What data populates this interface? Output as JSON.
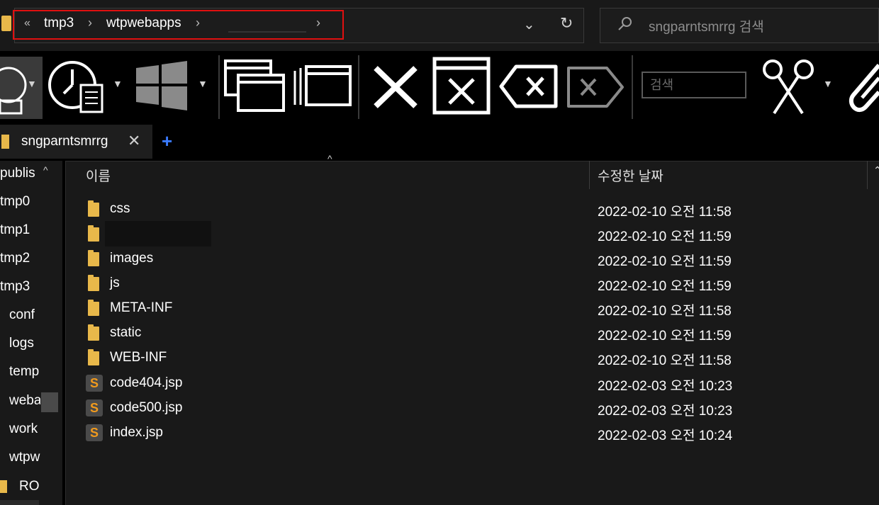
{
  "address": {
    "overflow": "«",
    "crumbs": [
      "tmp3",
      "wtpwebapps"
    ],
    "separator": "›",
    "chevron": "⌄",
    "refresh": "↻"
  },
  "search": {
    "placeholder": "sngparntsmrrg 검색"
  },
  "toolbar": {
    "search_placeholder": "검색",
    "items": [
      "drive-icon",
      "recent-files-icon",
      "windows-icon",
      "new-window-icon",
      "cascade-windows-icon",
      "close-icon",
      "close-window-icon",
      "backspace-icon",
      "tag-close-icon",
      "scissors-icon",
      "paperclip-icon"
    ]
  },
  "tabs": {
    "active_label": "sngparntsmrrg",
    "close": "✕",
    "add": "+"
  },
  "sidebar": {
    "items": [
      "publis",
      "tmp0",
      "tmp1",
      "tmp2",
      "tmp3",
      "conf",
      "logs",
      "temp",
      "weba",
      "work",
      "wtpw",
      "RO"
    ],
    "collapse": "^"
  },
  "columns": {
    "name": "이름",
    "date": "수정한 날짜",
    "sort": "^"
  },
  "files": [
    {
      "name": "css",
      "date": "2022-02-10 오전 11:58",
      "type": "folder"
    },
    {
      "name": "",
      "date": "2022-02-10 오전 11:59",
      "type": "folder"
    },
    {
      "name": "images",
      "date": "2022-02-10 오전 11:59",
      "type": "folder"
    },
    {
      "name": "js",
      "date": "2022-02-10 오전 11:59",
      "type": "folder"
    },
    {
      "name": "META-INF",
      "date": "2022-02-10 오전 11:58",
      "type": "folder"
    },
    {
      "name": "static",
      "date": "2022-02-10 오전 11:59",
      "type": "folder"
    },
    {
      "name": "WEB-INF",
      "date": "2022-02-10 오전 11:58",
      "type": "folder"
    },
    {
      "name": "code404.jsp",
      "date": "2022-02-03 오전 10:23",
      "type": "jsp"
    },
    {
      "name": "code500.jsp",
      "date": "2022-02-03 오전 10:23",
      "type": "jsp"
    },
    {
      "name": "index.jsp",
      "date": "2022-02-03 오전 10:24",
      "type": "jsp"
    }
  ],
  "colors": {
    "folder": "#e8b84a",
    "highlight": "#e01010",
    "accent": "#3a7bff",
    "jsp": "#f29b1d"
  }
}
